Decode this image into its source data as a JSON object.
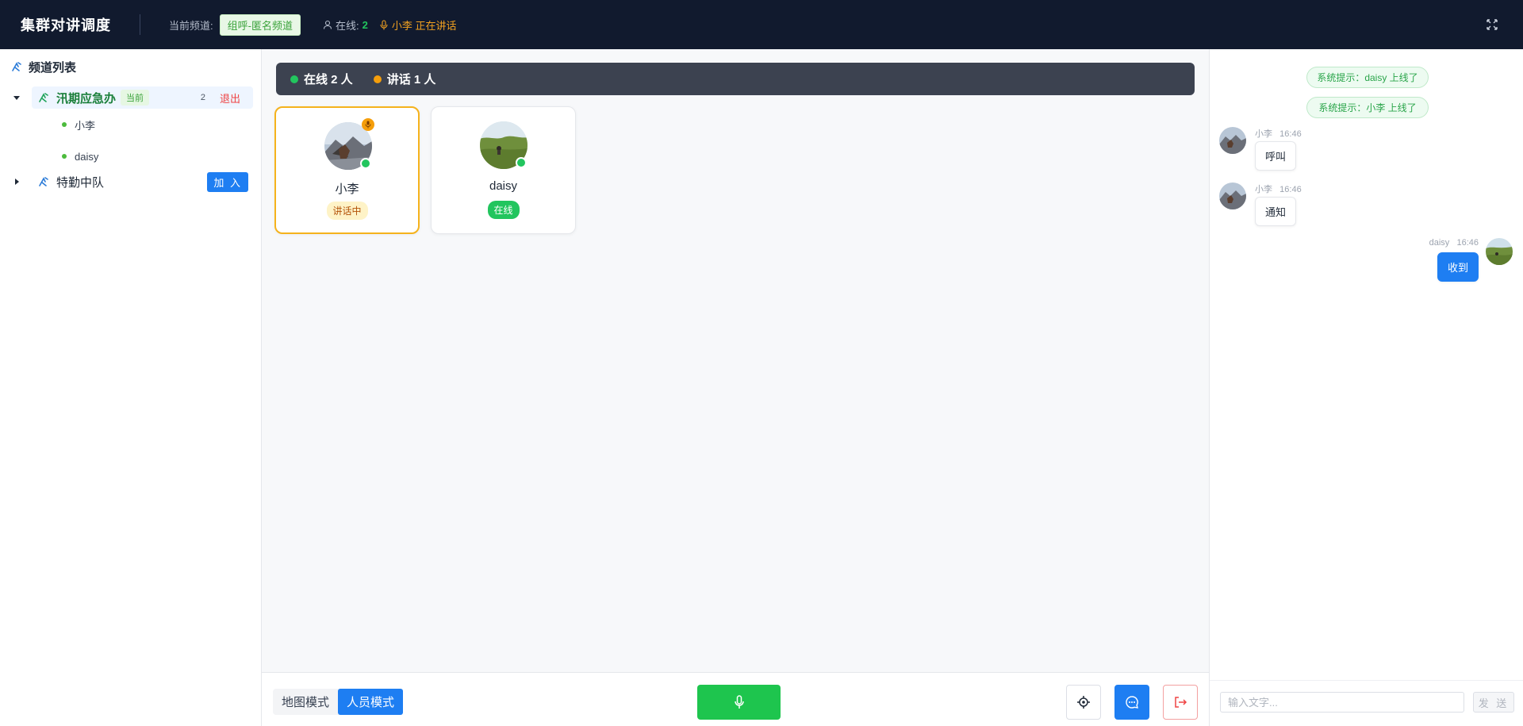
{
  "header": {
    "title": "集群对讲调度",
    "current_channel_label": "当前频道:",
    "current_channel": "组呼-匿名频道",
    "online_label": "在线:",
    "online_count": "2",
    "speaking_text": "小李 正在讲话"
  },
  "sidebar": {
    "title": "频道列表",
    "channels": [
      {
        "name": "汛期应急办",
        "current_tag": "当前",
        "count": "2",
        "leave_label": "退出",
        "members": [
          "小李",
          "daisy"
        ]
      },
      {
        "name": "特勤中队",
        "join_label": "加 入"
      }
    ]
  },
  "stats": {
    "online": "在线 2 人",
    "speaking": "讲话 1 人",
    "online_color": "#22c55e",
    "speaking_color": "#f59e0b"
  },
  "members": [
    {
      "name": "小李",
      "status": "讲话中"
    },
    {
      "name": "daisy",
      "status": "在线"
    }
  ],
  "bottom": {
    "map_mode": "地图模式",
    "people_mode": "人员模式"
  },
  "chat": {
    "system_messages": [
      "系统提示：daisy 上线了",
      "系统提示：小李 上线了"
    ],
    "messages": [
      {
        "sender": "小李",
        "time": "16:46",
        "text": "呼叫"
      },
      {
        "sender": "小李",
        "time": "16:46",
        "text": "通知"
      },
      {
        "sender": "daisy",
        "time": "16:46",
        "text": "收到"
      }
    ],
    "input_placeholder": "输入文字...",
    "send_label": "发 送"
  },
  "colors": {
    "accent": "#1e7ef2",
    "header_bg": "#111a2e",
    "ptt": "#1ec54e",
    "channel_active": "#1a7f3a"
  }
}
